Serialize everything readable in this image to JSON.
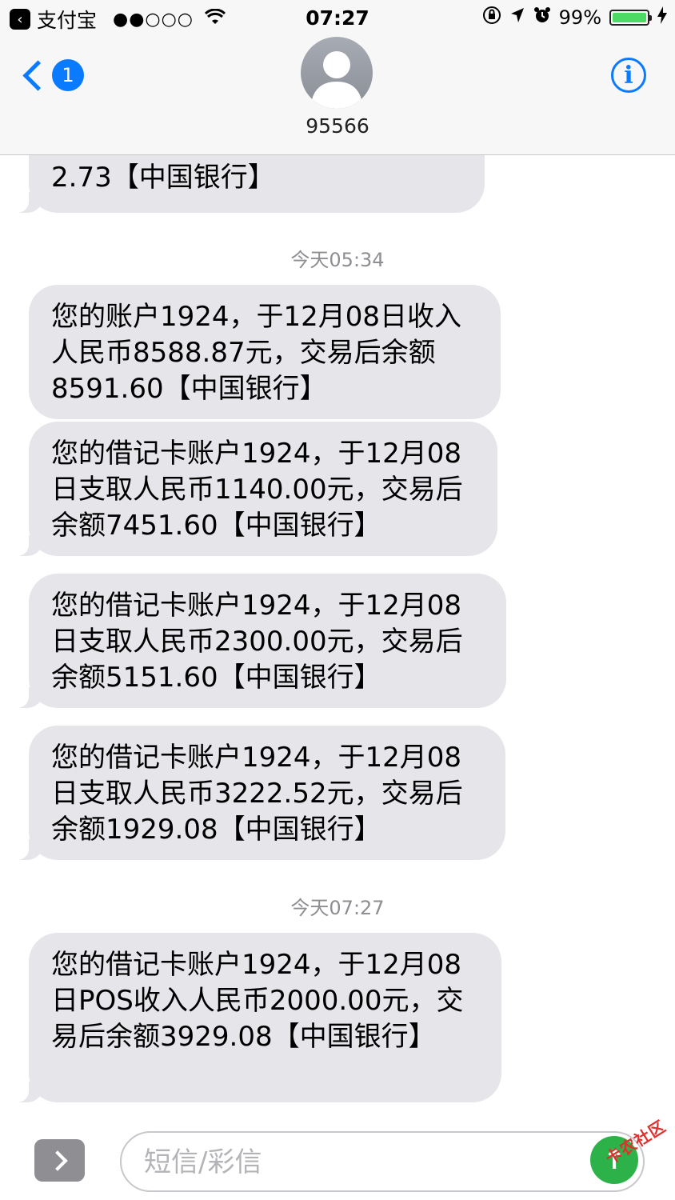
{
  "status_bar": {
    "carrier": "支付宝",
    "time": "07:27",
    "battery": "99%",
    "battery_level": 0.99
  },
  "header": {
    "unread_count": "1",
    "contact_name": "95566"
  },
  "messages": [
    {
      "text": "2.73【中国银行】"
    },
    {
      "timestamp": "今天05:34"
    },
    {
      "text": "您的账户1924，于12月08日收入人民币8588.87元，交易后余额8591.60【中国银行】"
    },
    {
      "text": "您的借记卡账户1924，于12月08日支取人民币1140.00元，交易后余额7451.60【中国银行】"
    },
    {
      "text": "您的借记卡账户1924，于12月08日支取人民币2300.00元，交易后余额5151.60【中国银行】"
    },
    {
      "text": "您的借记卡账户1924，于12月08日支取人民币3222.52元，交易后余额1929.08【中国银行】"
    },
    {
      "timestamp": "今天07:27"
    },
    {
      "text": "您的借记卡账户1924，于12月08日POS收入人民币2000.00元，交易后余额3929.08【中国银行】"
    }
  ],
  "composer": {
    "placeholder": "短信/彩信",
    "value": ""
  },
  "watermark": "卡农社区"
}
